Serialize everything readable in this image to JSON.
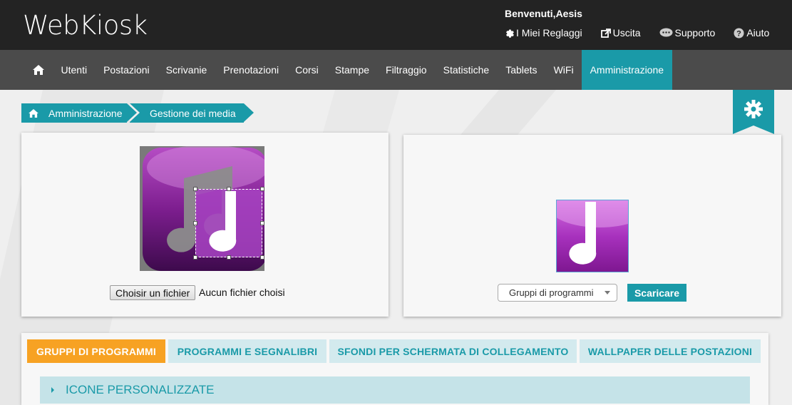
{
  "header": {
    "logo": "WebKiosk",
    "welcome": "Benvenuti,Aesis",
    "links": [
      {
        "label": "I Miei Reglaggi",
        "icon": "gear-icon"
      },
      {
        "label": "Uscita",
        "icon": "external-link-icon"
      },
      {
        "label": "Supporto",
        "icon": "chat-bubble-icon"
      },
      {
        "label": "Aiuto",
        "icon": "question-circle-icon"
      }
    ]
  },
  "nav": {
    "home_icon": "home-icon",
    "items": [
      "Utenti",
      "Postazioni",
      "Scrivanie",
      "Prenotazioni",
      "Corsi",
      "Stampe",
      "Filtraggio",
      "Statistiche",
      "Tablets",
      "WiFi",
      "Amministrazione"
    ],
    "active": "Amministrazione"
  },
  "breadcrumb": {
    "items": [
      "Amministrazione",
      "Gestione dei media"
    ]
  },
  "editor": {
    "file_button": "Choisir un fichier",
    "file_status": "Aucun fichier choisi"
  },
  "preview": {
    "select_value": "Gruppi di programmi",
    "download_label": "Scaricare"
  },
  "tabs": {
    "items": [
      "GRUPPI DI PROGRAMMI",
      "PROGRAMMI E SEGNALIBRI",
      "SFONDI PER SCHERMATA DI COLLEGAMENTO",
      "WALLPAPER DELLE POSTAZIONI"
    ],
    "active": "GRUPPI DI PROGRAMMI"
  },
  "accordion": {
    "label": "ICONE PERSONALIZZATE"
  },
  "colors": {
    "accent": "#1a9aa8",
    "active_tab": "#f7a223",
    "header_bg": "#232323",
    "nav_bg": "#4b4b4b"
  }
}
